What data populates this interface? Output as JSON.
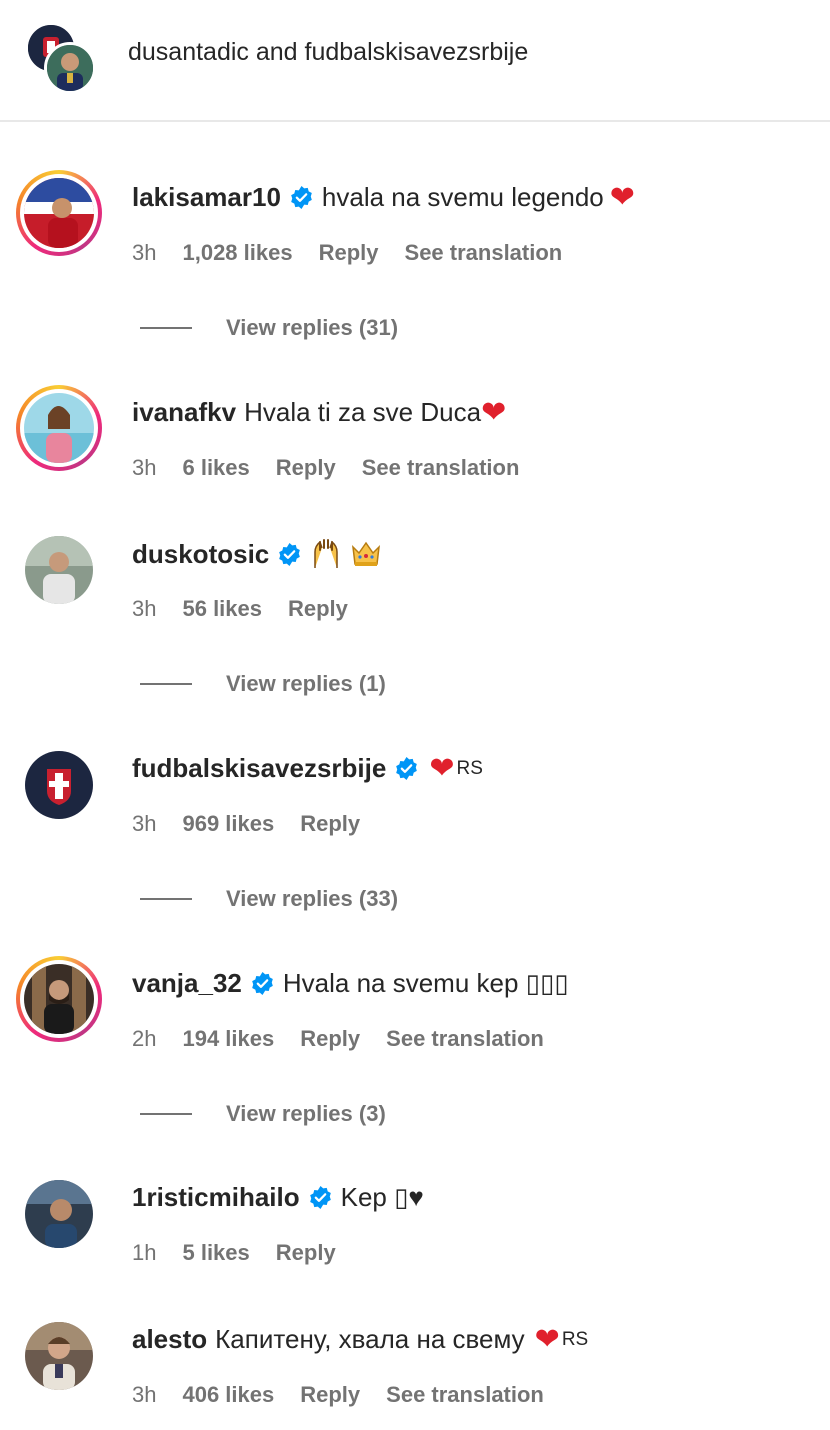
{
  "header": {
    "title": "dusantadic and fudbalskisavezsrbije"
  },
  "comments": [
    {
      "username": "lakisamar10",
      "verified": true,
      "text": "hvala na svemu legendo",
      "time": "3h",
      "likes": "1,028 likes",
      "reply": "Reply",
      "translation": "See translation",
      "view_replies": "View replies (31)"
    },
    {
      "username": "ivanafkv",
      "verified": false,
      "text": "Hvala ti za sve Duca",
      "time": "3h",
      "likes": "6 likes",
      "reply": "Reply",
      "translation": "See translation"
    },
    {
      "username": "duskotosic",
      "verified": true,
      "text": "",
      "time": "3h",
      "likes": "56 likes",
      "reply": "Reply",
      "view_replies": "View replies (1)"
    },
    {
      "username": "fudbalskisavezsrbije",
      "verified": true,
      "text": "",
      "flag": "RS",
      "time": "3h",
      "likes": "969 likes",
      "reply": "Reply",
      "view_replies": "View replies (33)"
    },
    {
      "username": "vanja_32",
      "verified": true,
      "text": "Hvala na svemu kep ▯▯▯",
      "time": "2h",
      "likes": "194 likes",
      "reply": "Reply",
      "translation": "See translation",
      "view_replies": "View replies (3)"
    },
    {
      "username": "1risticmihailo",
      "verified": true,
      "text": "Kep ▯♥",
      "time": "1h",
      "likes": "5 likes",
      "reply": "Reply"
    },
    {
      "username": "alesto",
      "verified": false,
      "text": "Капитену, хвала на свему",
      "flag": "RS",
      "time": "3h",
      "likes": "406 likes",
      "reply": "Reply",
      "translation": "See translation"
    }
  ],
  "colors": {
    "verified": "#0095f6",
    "heart": "#e0202c",
    "meta": "#737373"
  }
}
